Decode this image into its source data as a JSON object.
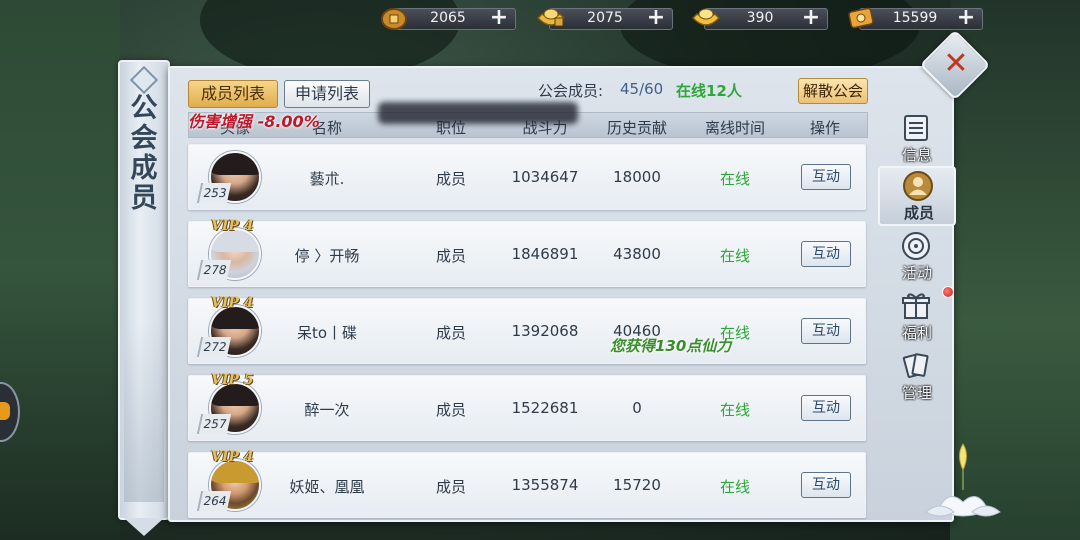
{
  "currencies": [
    {
      "icon": "copper-coin-icon",
      "value": "2065"
    },
    {
      "icon": "locked-gold-ingot-icon",
      "value": "2075"
    },
    {
      "icon": "gold-ingot-icon",
      "value": "390"
    },
    {
      "icon": "coupon-icon",
      "value": "15599"
    }
  ],
  "title": "公会成员",
  "tabs": {
    "members": "成员列表",
    "applications": "申请列表"
  },
  "summary": {
    "label": "公会成员:",
    "count": "45/60",
    "online": "在线12人"
  },
  "disband_label": "解散公会",
  "headers": {
    "avatar": "头像",
    "name": "名称",
    "position": "职位",
    "power": "战斗力",
    "contribution": "历史贡献",
    "offline_time": "离线时间",
    "action": "操作"
  },
  "floating": {
    "damage_boost": "伤害增强 -8.00%",
    "gain": "您获得130点仙力"
  },
  "members": [
    {
      "level": "253",
      "vip": "",
      "name": "藝朮.",
      "position": "成员",
      "power": "1034647",
      "contribution": "18000",
      "status": "在线",
      "action": "互动"
    },
    {
      "level": "278",
      "vip": "VIP 4",
      "name": "停 〉开畅",
      "position": "成员",
      "power": "1846891",
      "contribution": "43800",
      "status": "在线",
      "action": "互动"
    },
    {
      "level": "272",
      "vip": "VIP 4",
      "name": "呆to丨碟",
      "position": "成员",
      "power": "1392068",
      "contribution": "40460",
      "status": "在线",
      "action": "互动"
    },
    {
      "level": "257",
      "vip": "VIP 5",
      "name": "醉一次",
      "position": "成员",
      "power": "1522681",
      "contribution": "0",
      "status": "在线",
      "action": "互动"
    },
    {
      "level": "264",
      "vip": "VIP 4",
      "name": "妖姬、凰凰",
      "position": "成员",
      "power": "1355874",
      "contribution": "15720",
      "status": "在线",
      "action": "互动"
    }
  ],
  "side_nav": [
    {
      "label": "信息",
      "icon": "scroll-icon"
    },
    {
      "label": "成员",
      "icon": "members-icon"
    },
    {
      "label": "活动",
      "icon": "activity-icon"
    },
    {
      "label": "福利",
      "icon": "gift-icon"
    },
    {
      "label": "管理",
      "icon": "manage-cards-icon"
    }
  ]
}
